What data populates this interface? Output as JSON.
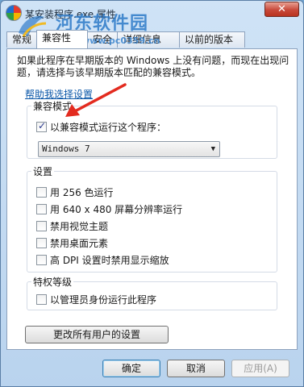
{
  "window": {
    "title": "某安装程序.exe 属性",
    "close_label": "✕"
  },
  "watermark": {
    "site_name": "河东软件园",
    "url": "www.pc0359.cn"
  },
  "tabs": [
    {
      "label": "常规"
    },
    {
      "label": "兼容性"
    },
    {
      "label": "安全"
    },
    {
      "label": "详细信息"
    },
    {
      "label": "以前的版本"
    }
  ],
  "intro": {
    "text": "如果此程序在早期版本的 Windows 上没有问题，而现在出现问题，请选择与该早期版本匹配的兼容模式。"
  },
  "help_link": "帮助我选择设置",
  "compat_mode": {
    "group_label": "兼容模式",
    "checkbox_label": "以兼容模式运行这个程序：",
    "checked": true,
    "selected_os": "Windows 7"
  },
  "settings": {
    "group_label": "设置",
    "items": [
      {
        "label": "用 256 色运行",
        "checked": false
      },
      {
        "label": "用 640 x 480 屏幕分辨率运行",
        "checked": false
      },
      {
        "label": "禁用视觉主题",
        "checked": false
      },
      {
        "label": "禁用桌面元素",
        "checked": false
      },
      {
        "label": "高 DPI 设置时禁用显示缩放",
        "checked": false
      }
    ]
  },
  "privilege": {
    "group_label": "特权等级",
    "checkbox_label": "以管理员身份运行此程序",
    "checked": false
  },
  "buttons": {
    "change_all_users": "更改所有用户的设置",
    "ok": "确定",
    "cancel": "取消",
    "apply": "应用(A)"
  },
  "colors": {
    "title_bar": "#cfe3f6",
    "link": "#0b57a8",
    "close_button": "#c8493a",
    "annotation_arrow": "#e32b1f",
    "watermark": "#2e7bc9"
  }
}
